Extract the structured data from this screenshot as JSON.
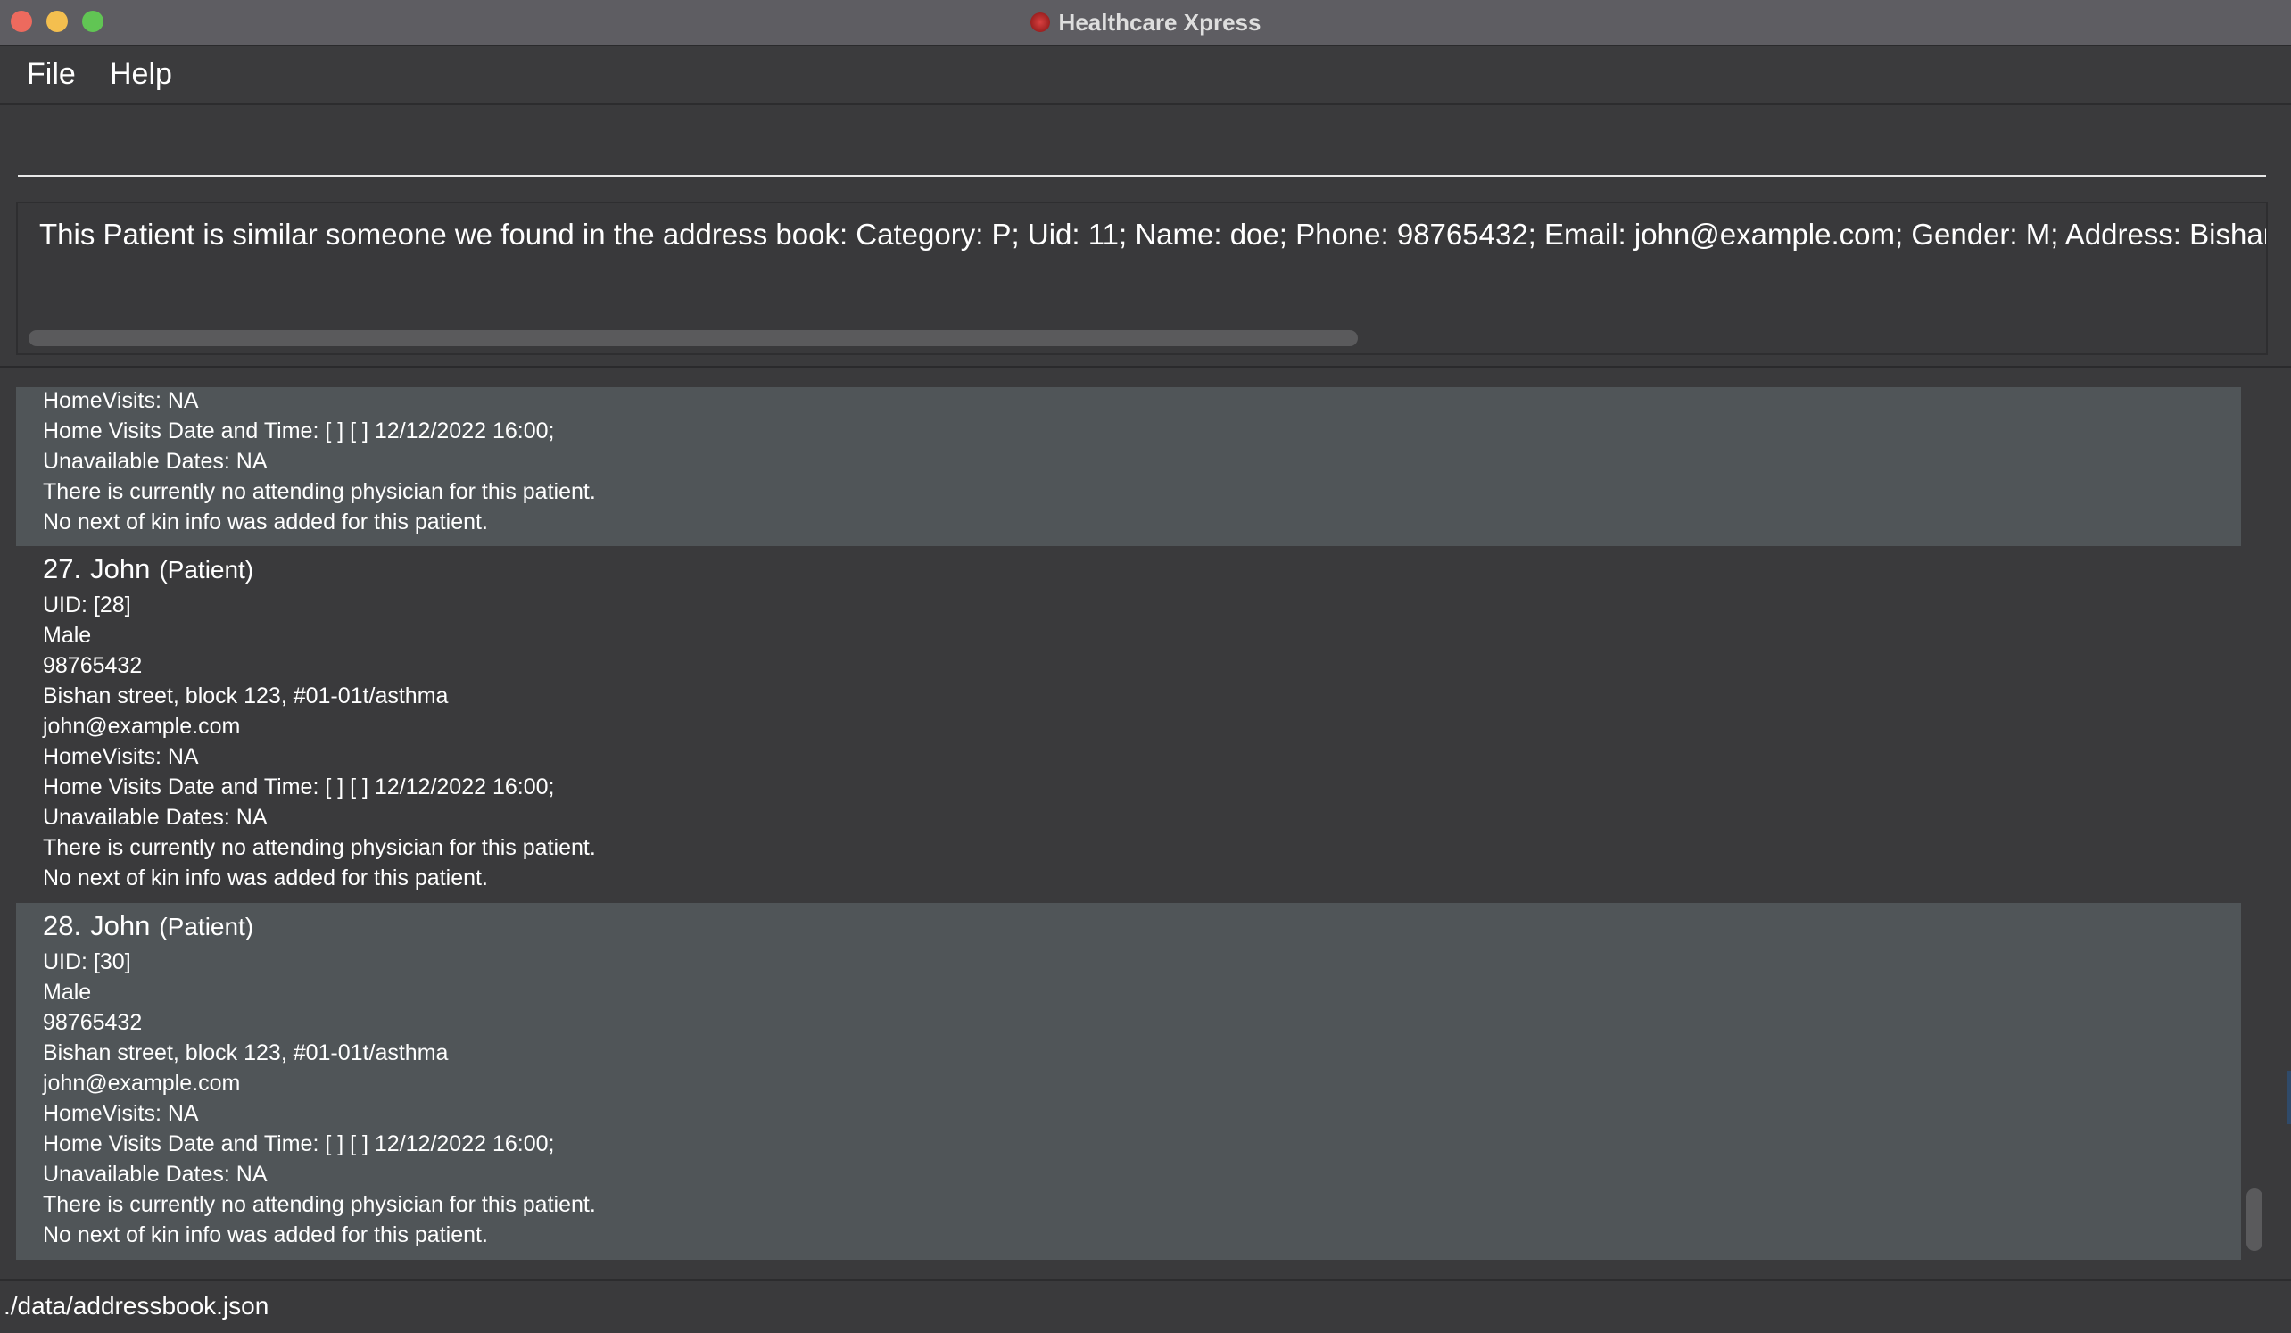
{
  "window": {
    "title": "Healthcare Xpress"
  },
  "menu": {
    "file": "File",
    "help": "Help"
  },
  "command": {
    "value": "",
    "placeholder": ""
  },
  "result": {
    "text": "This Patient is similar someone we found in the address book: Category: P; Uid: 11; Name: doe; Phone: 98765432; Email: john@example.com; Gender: M; Address: Bishan stre"
  },
  "partial_card": {
    "lines": [
      "HomeVisits: NA",
      "Home Visits Date and Time: [ ] [ ] 12/12/2022 16:00;",
      "Unavailable Dates: NA",
      "There is currently no attending physician for this patient.",
      "No next of kin info was added for this patient."
    ]
  },
  "cards": [
    {
      "index": "27.",
      "name": "John",
      "category": "(Patient)",
      "uid": "UID: [28]",
      "gender": "Male",
      "phone": "98765432",
      "address": "Bishan street, block 123, #01-01t/asthma",
      "email": "john@example.com",
      "home_visits": "HomeVisits: NA",
      "home_visits_datetime": "Home Visits Date and Time: [ ] [ ] 12/12/2022 16:00;",
      "unavailable": "Unavailable Dates: NA",
      "physician": "There is currently no attending physician for this patient.",
      "next_of_kin": "No next of kin info was added for this patient."
    },
    {
      "index": "28.",
      "name": "John",
      "category": "(Patient)",
      "uid": "UID: [30]",
      "gender": "Male",
      "phone": "98765432",
      "address": "Bishan street, block 123, #01-01t/asthma",
      "email": "john@example.com",
      "home_visits": "HomeVisits: NA",
      "home_visits_datetime": "Home Visits Date and Time: [ ] [ ] 12/12/2022 16:00;",
      "unavailable": "Unavailable Dates: NA",
      "physician": "There is currently no attending physician for this patient.",
      "next_of_kin": "No next of kin info was added for this patient."
    }
  ],
  "status": {
    "path": "./data/addressbook.json"
  },
  "colors": {
    "card_light": "#505558",
    "card_dark": "#3a3a3c",
    "background": "#3a3a3c"
  }
}
